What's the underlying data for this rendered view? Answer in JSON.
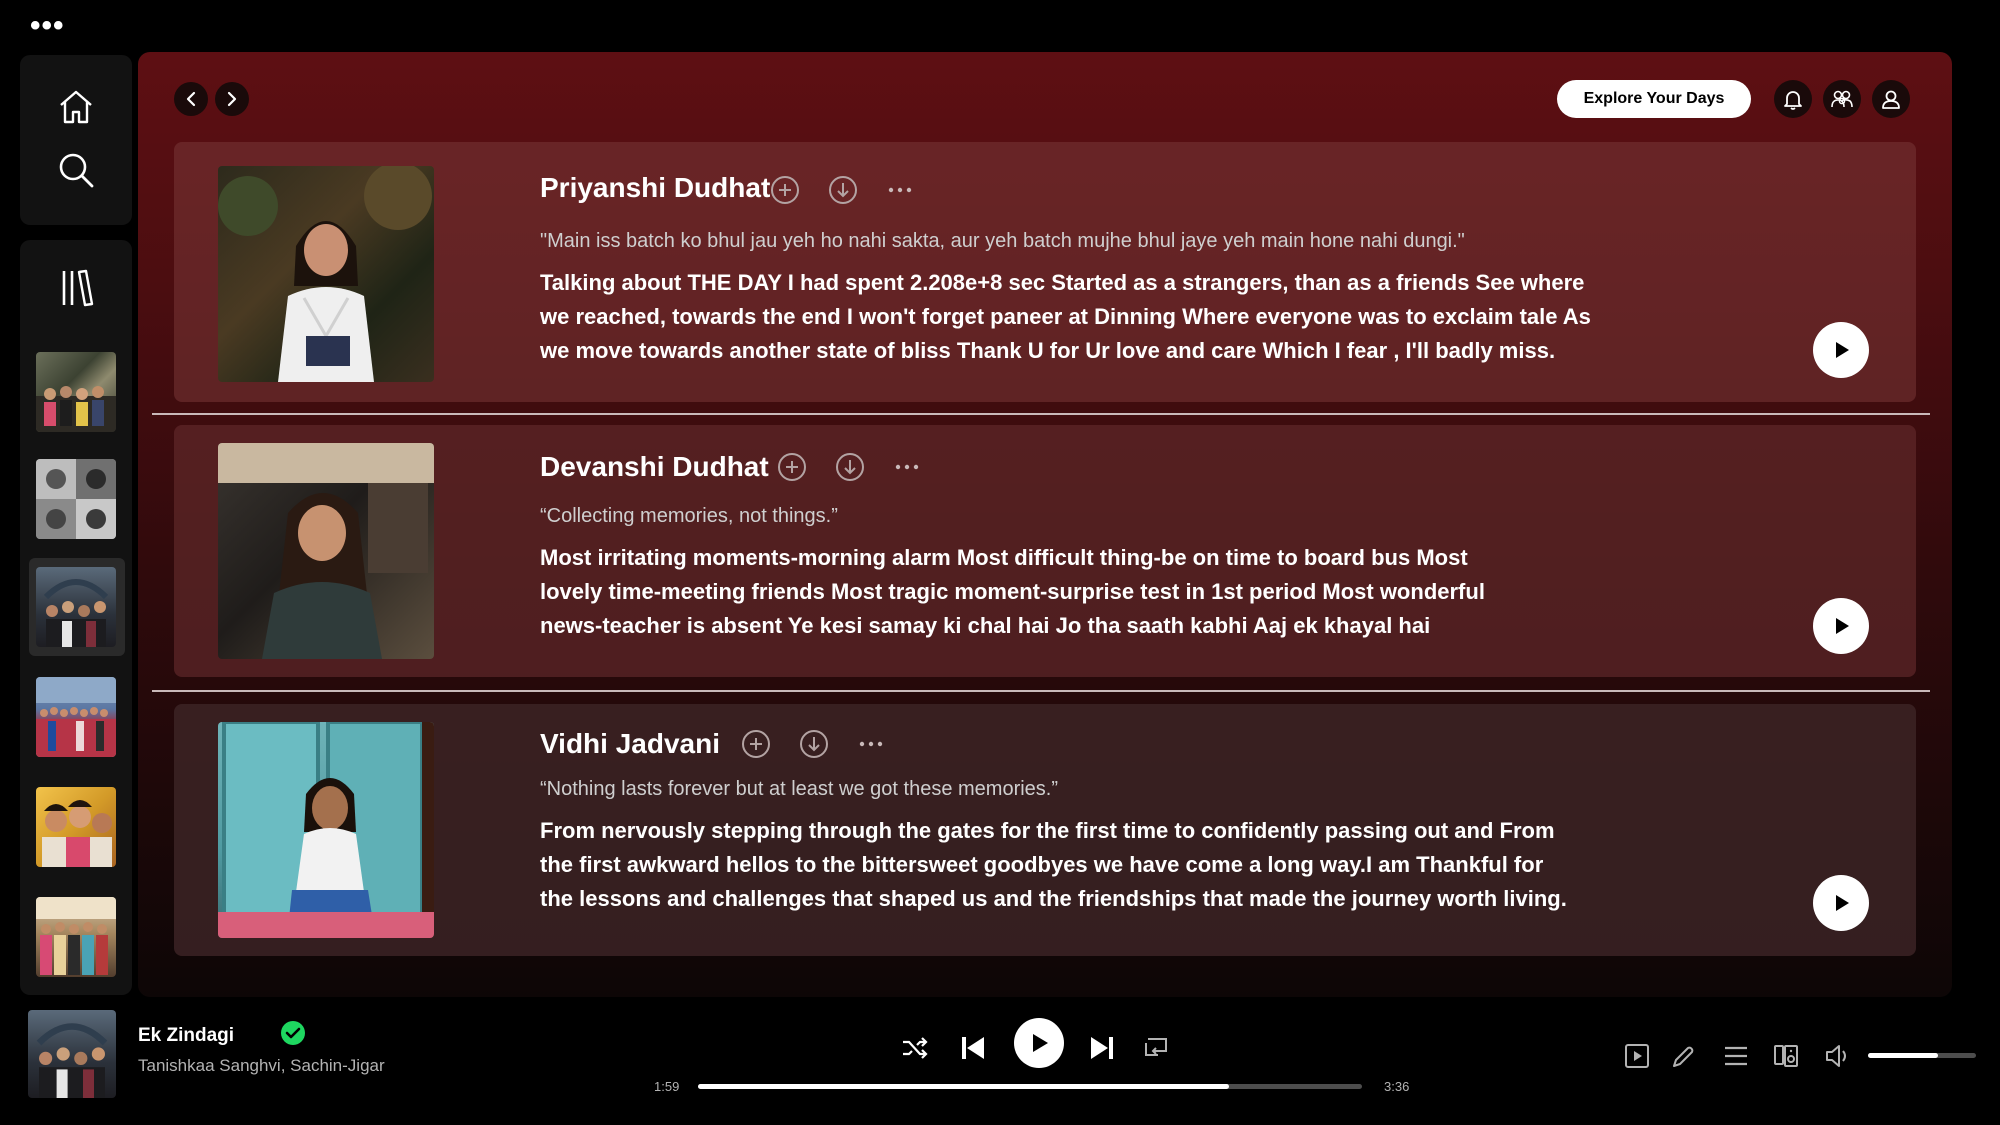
{
  "window": {
    "menu_icon": "more-dots-icon"
  },
  "sidebar": {
    "nav": [
      {
        "name": "home",
        "icon": "home-icon"
      },
      {
        "name": "search",
        "icon": "search-icon"
      }
    ],
    "library_icon": "library-icon",
    "playlists": [
      {
        "name": "group-photo-1"
      },
      {
        "name": "group-photo-2"
      },
      {
        "name": "group-photo-3",
        "active": true
      },
      {
        "name": "group-photo-4"
      },
      {
        "name": "group-photo-5"
      },
      {
        "name": "group-photo-6"
      }
    ]
  },
  "header": {
    "explore_label": "Explore Your Days",
    "icons": [
      "bell-icon",
      "friends-icon",
      "profile-icon"
    ]
  },
  "cards": [
    {
      "name": "Priyanshi Dudhat",
      "quote": "\"Main iss batch ko bhul jau yeh ho nahi sakta, aur yeh batch mujhe bhul jaye yeh main hone nahi dungi.\"",
      "lines": [
        "Talking about THE DAY I had spent 2.208e+8 sec Started as a strangers, than as a friends See where",
        "we reached, towards the end I won't forget paneer at Dinning Where everyone was to exclaim tale As",
        "we move towards another state of bliss Thank U for Ur love and care Which I fear , I'll badly miss."
      ]
    },
    {
      "name": "Devanshi Dudhat",
      "quote": "“Collecting memories, not things.”",
      "lines": [
        "Most irritating moments-morning alarm Most difficult thing-be on time to board bus Most",
        "lovely time-meeting friends Most tragic moment-surprise test in 1st period Most wonderful",
        "news-teacher is absent Ye kesi samay ki chal hai Jo tha saath kabhi Aaj ek khayal hai"
      ]
    },
    {
      "name": "Vidhi Jadvani",
      "quote": "“Nothing lasts forever but at least we got these memories.”",
      "lines": [
        "From nervously stepping through the gates for the first time to confidently passing out and From",
        "the first awkward hellos to the bittersweet goodbyes we have come a long way.I am Thankful for",
        "the lessons and challenges that shaped us and the friendships that made the journey worth living."
      ]
    }
  ],
  "player": {
    "title": "Ek Zindagi",
    "artist": "Tanishkaa Sanghvi, Sachin-Jigar",
    "elapsed": "1:59",
    "duration": "3:36",
    "progress": 0.8,
    "volume": 0.65,
    "accent": "#1ed760"
  }
}
